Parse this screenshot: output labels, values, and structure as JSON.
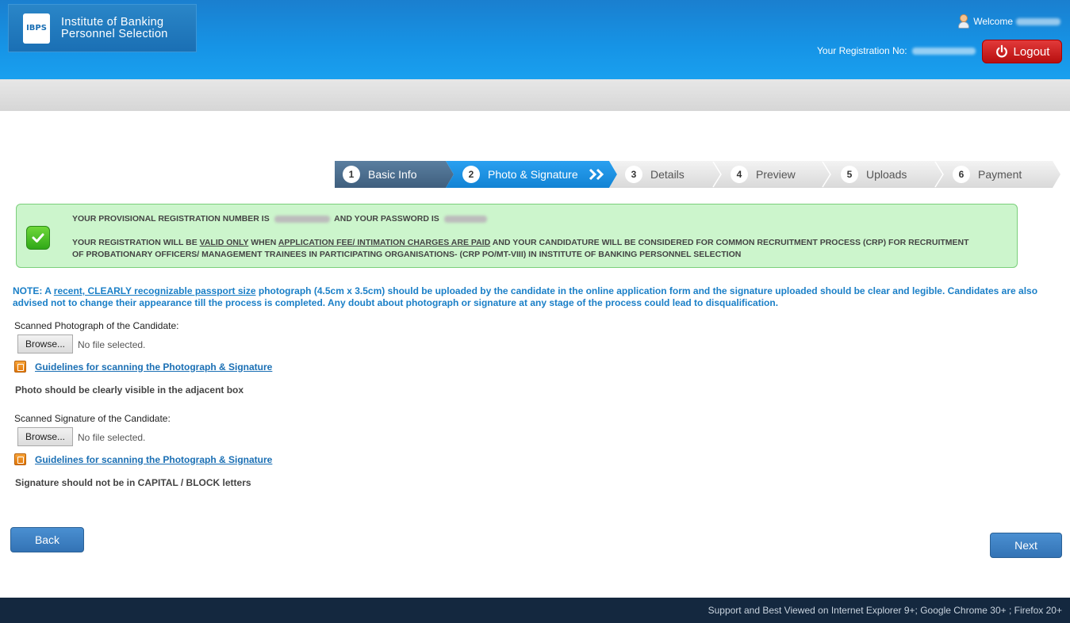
{
  "header": {
    "logo_line1": "Institute of Banking",
    "logo_line2": "Personnel Selection",
    "logo_mark": "IBPS",
    "welcome_label": "Welcome",
    "registration_label": "Your Registration No:",
    "logout_label": "Logout",
    "logout_icon": "power-icon"
  },
  "steps": [
    {
      "num": "1",
      "label": "Basic Info",
      "state": "completed"
    },
    {
      "num": "2",
      "label": "Photo & Signature",
      "state": "active"
    },
    {
      "num": "3",
      "label": "Details",
      "state": "pending"
    },
    {
      "num": "4",
      "label": "Preview",
      "state": "pending"
    },
    {
      "num": "5",
      "label": "Uploads",
      "state": "pending"
    },
    {
      "num": "6",
      "label": "Payment",
      "state": "pending"
    }
  ],
  "success": {
    "line1_a": "YOUR PROVISIONAL REGISTRATION NUMBER IS",
    "line1_b": "AND YOUR PASSWORD IS",
    "line2_a": "YOUR REGISTRATION WILL BE ",
    "line2_valid": "VALID ONLY",
    "line2_b": " WHEN ",
    "line2_fee": "APPLICATION FEE/ INTIMATION CHARGES ARE PAID",
    "line2_c": " AND YOUR CANDIDATURE WILL BE CONSIDERED FOR COMMON RECRUITMENT PROCESS (CRP) FOR RECRUITMENT",
    "line3": "OF PROBATIONARY OFFICERS/ MANAGEMENT TRAINEES IN PARTICIPATING ORGANISATIONS- (CRP PO/MT-VIII) IN INSTITUTE OF BANKING PERSONNEL SELECTION"
  },
  "note": {
    "prefix": "NOTE: A ",
    "underlined": "recent, CLEARLY recognizable passport size",
    "rest": " photograph (4.5cm x 3.5cm) should be uploaded by the candidate in the online application form and the signature uploaded should be clear and legible. Candidates are also advised not to change their appearance till the process is completed. Any doubt about photograph or signature at any stage of the process could lead to disqualification."
  },
  "photo": {
    "label": "Scanned Photograph of the Candidate:",
    "browse_label": "Browse...",
    "file_status": "No file selected.",
    "guide_link": "Guidelines for scanning the Photograph & Signature",
    "hint": "Photo should be clearly visible in the adjacent box"
  },
  "signature": {
    "label": "Scanned Signature of the Candidate:",
    "browse_label": "Browse...",
    "file_status": "No file selected.",
    "guide_link": "Guidelines for scanning the Photograph & Signature",
    "hint": "Signature should not be in CAPITAL / BLOCK letters"
  },
  "buttons": {
    "back": "Back",
    "next": "Next"
  },
  "footer": {
    "text": "Support and Best Viewed on Internet Explorer 9+; Google Chrome 30+ ; Firefox 20+"
  },
  "colors": {
    "header_blue": "#1694e6",
    "step_completed": "#4a6c8c",
    "step_active": "#1a8fe0",
    "step_pending": "#e0e0e0",
    "success_bg": "#ccf5cc",
    "note_blue": "#1a7fc7",
    "logout_red": "#c81e1e",
    "button_blue": "#3f80c3",
    "footer_bg": "#14283f"
  }
}
